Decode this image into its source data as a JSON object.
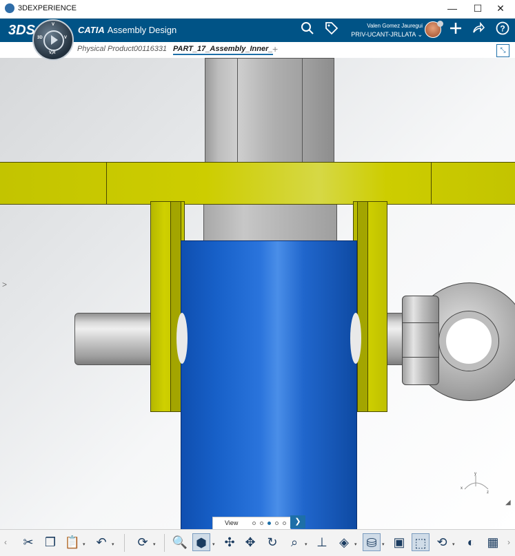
{
  "window": {
    "title": "3DEXPERIENCE",
    "minimize": "—",
    "maximize": "☐",
    "close": "✕"
  },
  "header": {
    "brand": "CATIA",
    "app_name": "Assembly Design",
    "user_name": "Valen Gomez Jauregui",
    "tenant": "PRIV-UCANT-JRLLATA",
    "compass": {
      "top": "V",
      "left": "3D",
      "right": "V",
      "bottom": "V,R"
    }
  },
  "tabs": [
    {
      "label": "Physical Product00116331",
      "active": false
    },
    {
      "label": "PART_17_Assembly_Inner_",
      "active": true
    }
  ],
  "tab_add": "+",
  "viewport": {
    "triad": {
      "x": "x",
      "y": "y",
      "z": "z"
    }
  },
  "view_pager": {
    "label": "View",
    "pages": 5,
    "active_page": 3
  },
  "colors": {
    "header": "#005386",
    "accent": "#1d6fa8",
    "cylinder": "#1760c8",
    "bracket": "#cdcd00",
    "steel": "#bdbdbd"
  },
  "toolbar": {
    "icons": [
      "scissors-icon",
      "copy-icon",
      "paste-icon",
      "undo-icon",
      "update-icon",
      "zoom-area-icon",
      "view-mode-icon",
      "fit-all-icon",
      "pan-icon",
      "rotate-icon",
      "zoom-icon",
      "normal-view-icon",
      "view-cube-icon",
      "display-mode-icon",
      "cover-icon",
      "selection-filter-icon",
      "refresh-icon",
      "lighting-icon",
      "ambient-icon",
      "grid-icon"
    ]
  }
}
